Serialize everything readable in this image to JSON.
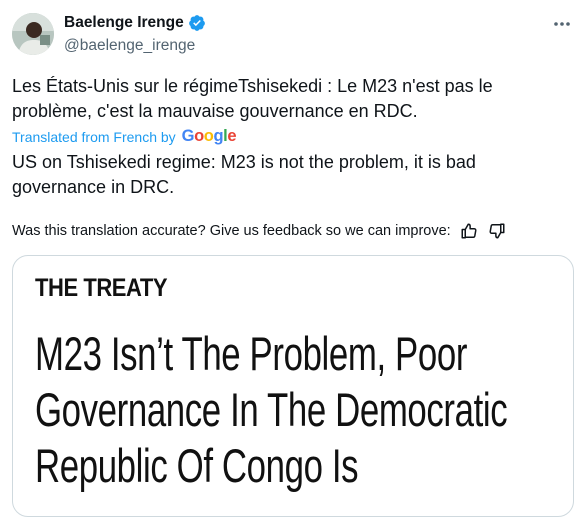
{
  "author": {
    "name": "Baelenge Irenge",
    "handle": "@baelenge_irenge"
  },
  "tweet": {
    "text": "Les États-Unis sur le régimeTshisekedi : Le M23 n'est pas le problème, c'est la mauvaise gouvernance en RDC.",
    "translated_from": "Translated from French by",
    "translator_brand": "Google",
    "translation": "US on Tshisekedi regime: M23 is not the problem, it is bad governance in DRC.",
    "feedback_prompt": "Was this translation accurate? Give us feedback so we can improve:"
  },
  "media": {
    "brand": "THE TREATY",
    "headline": "M23 Isn’t The Problem, Poor Governance In The Democratic Republic Of Congo Is"
  },
  "icons": {
    "verified": "verified-badge-icon",
    "more": "more-options-icon",
    "thumbs_up": "thumbs-up-icon",
    "thumbs_down": "thumbs-down-icon"
  },
  "colors": {
    "accent": "#1d9bf0",
    "secondary_text": "#536471",
    "text": "#0f1419",
    "google_blue": "#4285F4",
    "google_red": "#EA4335",
    "google_yellow": "#FBBC05",
    "google_green": "#34A853"
  }
}
